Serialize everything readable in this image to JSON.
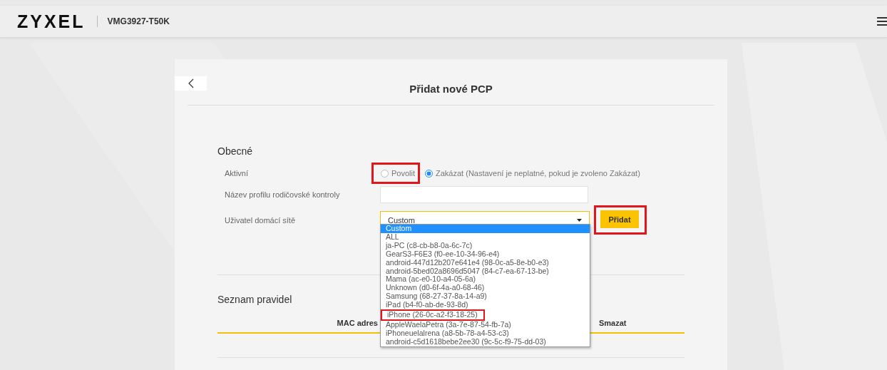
{
  "header": {
    "logo": "ZYXEL",
    "model": "VMG3927-T50K"
  },
  "card": {
    "title": "Přidat nové PCP"
  },
  "general": {
    "heading": "Obecné",
    "active": {
      "label": "Aktivní",
      "options": [
        {
          "label": "Povolit",
          "selected": false,
          "highlighted": true
        },
        {
          "label": "Zakázat (Nastavení je neplatné, pokud je zvoleno Zakázat)",
          "selected": true,
          "highlighted": false
        }
      ]
    },
    "profile_name": {
      "label": "Název profilu rodičovské kontroly"
    },
    "user": {
      "label": "Uživatel domácí sítě",
      "value": "Custom",
      "expanded": true,
      "options": [
        {
          "label": "Custom",
          "selected": true,
          "highlighted": false
        },
        {
          "label": "ALL",
          "selected": false,
          "highlighted": false
        },
        {
          "label": "ja-PC (c8-cb-b8-0a-6c-7c)",
          "selected": false,
          "highlighted": false
        },
        {
          "label": "GearS3-F6E3 (f0-ee-10-34-96-e4)",
          "selected": false,
          "highlighted": false
        },
        {
          "label": "android-447d12b207e641e4 (98-0c-a5-8e-b0-e3)",
          "selected": false,
          "highlighted": false
        },
        {
          "label": "android-5bed02a8696d5047 (84-c7-ea-67-13-be)",
          "selected": false,
          "highlighted": false
        },
        {
          "label": "Mama (ac-e0-10-a4-05-6a)",
          "selected": false,
          "highlighted": false
        },
        {
          "label": "Unknown (d0-6f-4a-a0-68-46)",
          "selected": false,
          "highlighted": false
        },
        {
          "label": "Samsung (68-27-37-8a-14-a9)",
          "selected": false,
          "highlighted": false
        },
        {
          "label": "iPad (b4-f0-ab-de-93-8d)",
          "selected": false,
          "highlighted": false
        },
        {
          "label": "iPhone (26-0c-a2-f3-18-25)",
          "selected": false,
          "highlighted": true
        },
        {
          "label": "AppleWaelaPetra (3a-7e-87-54-fb-7a)",
          "selected": false,
          "highlighted": false
        },
        {
          "label": "iPhoneuelalrena (a8-5b-78-a4-53-c3)",
          "selected": false,
          "highlighted": false
        },
        {
          "label": "android-c5d1618bebe2ee30 (9c-5c-f9-75-dd-03)",
          "selected": false,
          "highlighted": false
        }
      ]
    },
    "add_button": {
      "label": "Přidat",
      "highlighted": true
    }
  },
  "rules": {
    "heading": "Seznam pravidel",
    "columns": [
      "MAC adres",
      "Smazat"
    ]
  }
}
